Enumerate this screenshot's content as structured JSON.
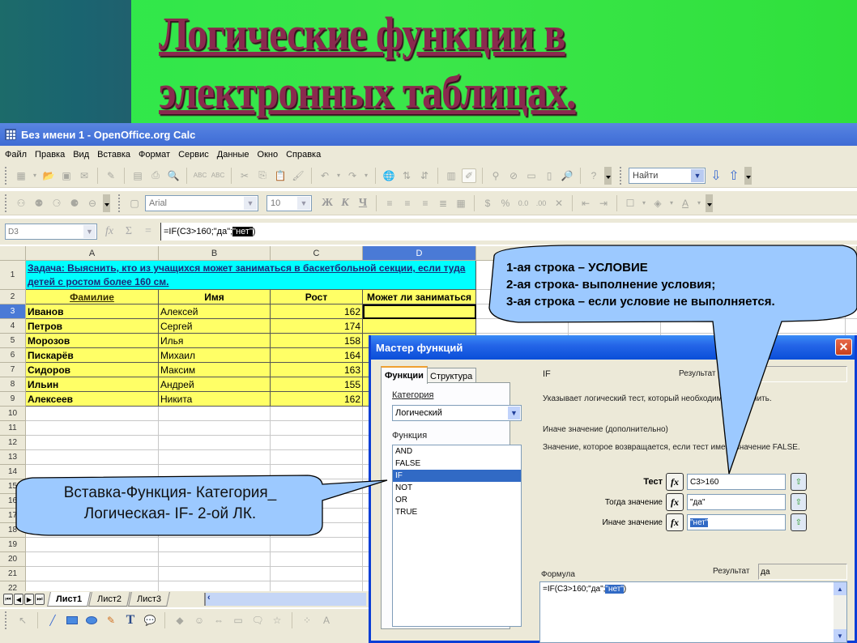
{
  "slide": {
    "title_line1": "Логические функции в",
    "title_line2": "электронных таблицах."
  },
  "window": {
    "title": "Без имени 1 - OpenOffice.org Calc"
  },
  "menu": [
    "Файл",
    "Правка",
    "Вид",
    "Вставка",
    "Формат",
    "Сервис",
    "Данные",
    "Окно",
    "Справка"
  ],
  "toolbar": {
    "find_placeholder": "Найти",
    "font_name": "Arial",
    "font_size": "10",
    "bold_label": "Ж",
    "italic_label": "К",
    "underline_label": "Ч"
  },
  "formula_bar": {
    "cell_ref": "D3",
    "formula_prefix": "=IF(C3>160;\"да\";",
    "formula_selected": "\"нет\"",
    "formula_suffix": ")"
  },
  "sheet": {
    "columns": [
      "A",
      "B",
      "C",
      "D"
    ],
    "active_column": "D",
    "active_row": 3,
    "task_text": "Задача:  Выяснить, кто из учащихся может заниматься в баскетбольной секции, если туда  детей с ростом более 160 см.",
    "headers": [
      "Фамилие",
      "Имя",
      "Рост",
      "Может ли заниматься"
    ],
    "rows": [
      {
        "last": "Иванов",
        "first": "Алексей",
        "height": "162"
      },
      {
        "last": "Петров",
        "first": "Сергей",
        "height": "174"
      },
      {
        "last": "Морозов",
        "first": "Илья",
        "height": "158"
      },
      {
        "last": "Пискарёв",
        "first": "Михаил",
        "height": "164"
      },
      {
        "last": "Сидоров",
        "first": "Максим",
        "height": "163"
      },
      {
        "last": "Ильин",
        "first": "Андрей",
        "height": "155"
      },
      {
        "last": "Алексеев",
        "first": "Никита",
        "height": "162"
      }
    ],
    "row_numbers": [
      "1",
      "2",
      "3",
      "4",
      "5",
      "6",
      "7",
      "8",
      "9",
      "10",
      "11",
      "12",
      "13",
      "14",
      "15",
      "16",
      "17",
      "18",
      "19",
      "20",
      "21",
      "22"
    ],
    "tabs": [
      "Лист1",
      "Лист2",
      "Лист3"
    ],
    "active_tab": "Лист1"
  },
  "dialog": {
    "title": "Мастер функций",
    "tabs": [
      "Функции",
      "Структура"
    ],
    "category_label": "Категория",
    "category_value": "Логический",
    "function_label": "Функция",
    "functions": [
      "AND",
      "FALSE",
      "IF",
      "NOT",
      "OR",
      "TRUE"
    ],
    "selected_function": "IF",
    "function_name": "IF",
    "result_label_top": "Результат",
    "description": "Указывает логический тест, который необходимо выполнить.",
    "arg_title": "Иначе значение (дополнительно)",
    "arg_description": "Значение, которое возвращается, если тест имеет значение FALSE.",
    "args": [
      {
        "label": "Тест",
        "value": "C3>160"
      },
      {
        "label": "Тогда значение",
        "value": "\"да\""
      },
      {
        "label": "Иначе значение",
        "value": "\"нет\""
      }
    ],
    "formula_label": "Формула",
    "result_label": "Результат",
    "result_value": "да",
    "formula_prefix": "=IF(C3>160;\"да\";",
    "formula_selected": "\"нет\"",
    "formula_suffix": ")"
  },
  "callouts": {
    "top_right": [
      "1-ая строка – УСЛОВИЕ",
      "2-ая строка- выполнение условия;",
      "3-ая строка – если условие не выполняется."
    ],
    "left_line1": "Вставка-Функция- Категория_",
    "left_line2": "Логическая- IF- 2-ой ЛК."
  }
}
